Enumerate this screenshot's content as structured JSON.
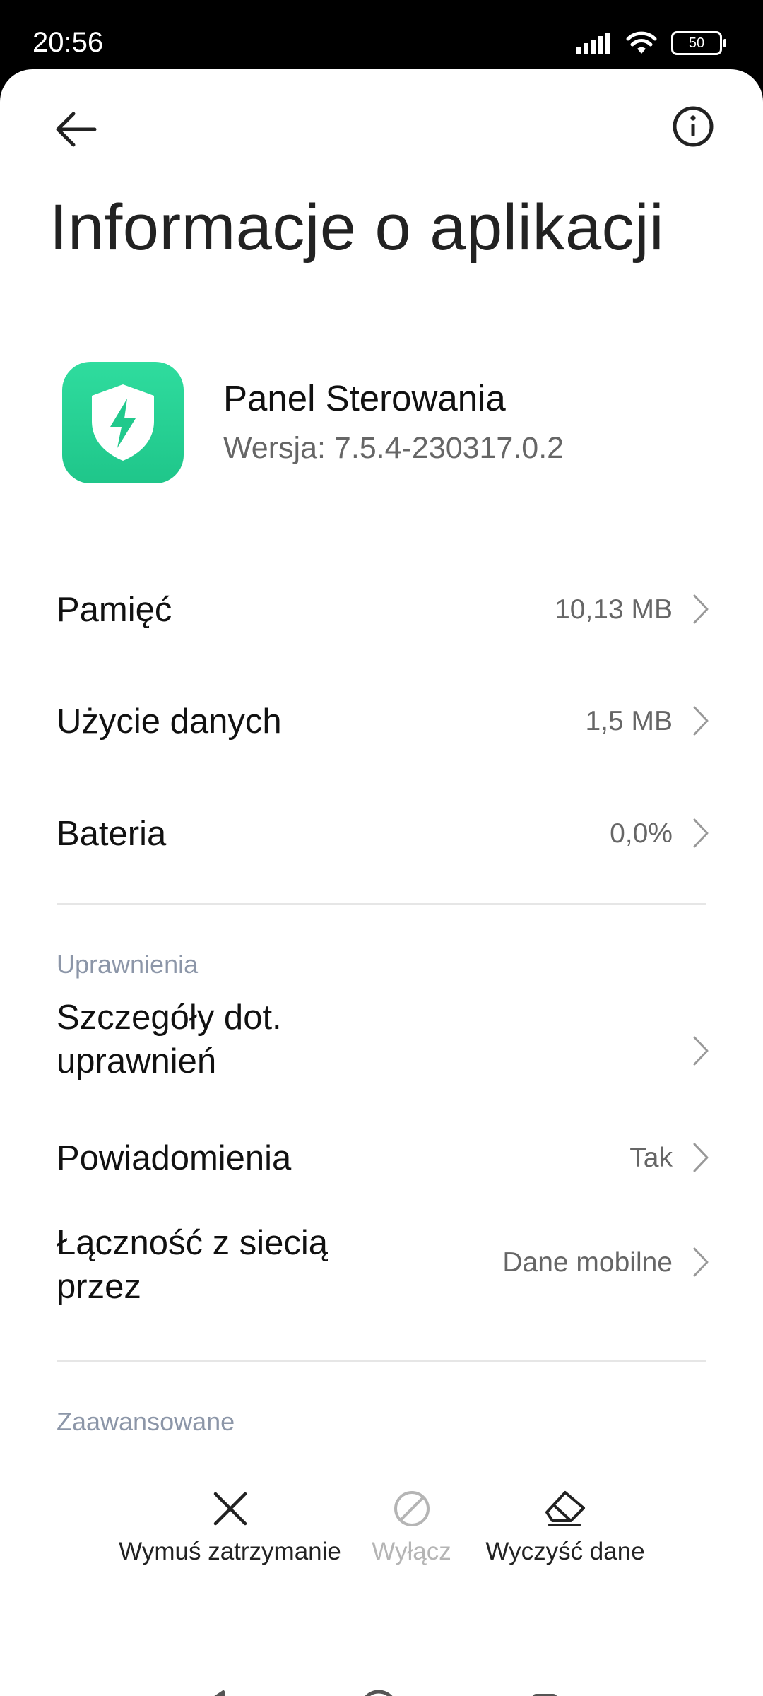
{
  "status_bar": {
    "time": "20:56",
    "battery": "50"
  },
  "header": {
    "title": "Informacje o aplikacji"
  },
  "app": {
    "name": "Panel Sterowania",
    "version": "Wersja: 7.5.4-230317.0.2",
    "icon_color": "#21c98c"
  },
  "usage": [
    {
      "label": "Pamięć",
      "value": "10,13 MB"
    },
    {
      "label": "Użycie danych",
      "value": "1,5 MB"
    },
    {
      "label": "Bateria",
      "value": "0,0%"
    }
  ],
  "permissions": {
    "section": "Uprawnienia",
    "items": [
      {
        "label_line1": "Szczegóły dot.",
        "label_line2": "uprawnień",
        "value": ""
      },
      {
        "label": "Powiadomienia",
        "value": "Tak"
      },
      {
        "label_line1": "Łączność z siecią",
        "label_line2": "przez",
        "value": "Dane mobilne"
      }
    ]
  },
  "advanced": {
    "section": "Zaawansowane"
  },
  "actions": [
    {
      "label": "Wymuś zatrzymanie",
      "icon": "close-icon",
      "enabled": true
    },
    {
      "label": "Wyłącz",
      "icon": "block-icon",
      "enabled": false
    },
    {
      "label": "Wyczyść dane",
      "icon": "eraser-icon",
      "enabled": true
    }
  ]
}
